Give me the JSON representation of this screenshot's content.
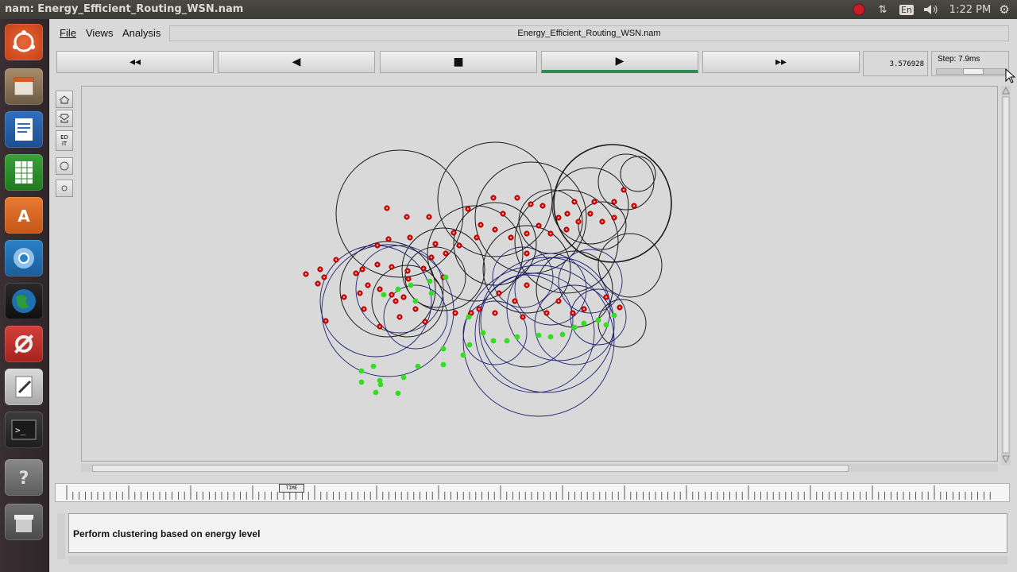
{
  "system": {
    "window_title": "nam: Energy_Efficient_Routing_WSN.nam",
    "clock": "1:22 PM",
    "keyboard_layout": "En"
  },
  "launcher": {
    "items": [
      "ubuntu-home",
      "files",
      "libreoffice-writer",
      "libreoffice-calc",
      "software-center",
      "chromium",
      "earth",
      "system-settings",
      "text-editor",
      "terminal",
      "help",
      "trash"
    ]
  },
  "nam": {
    "menus": [
      "File",
      "Views",
      "Analysis"
    ],
    "filename": "Energy_Efficient_Routing_WSN.nam",
    "controls": {
      "rewind": "◂◂",
      "back": "◀",
      "stop": "■",
      "play": "▶",
      "fast_forward": "▸▸"
    },
    "time": "3.576928",
    "step": "Step: 7.9ms",
    "step_slider_fraction": 0.55,
    "tools": [
      "zoom-in",
      "zoom-out",
      "EDIT",
      "node",
      "small-node"
    ],
    "timeline_marker": "TIME",
    "annotation": "Perform clustering based on energy level"
  },
  "colors": {
    "red_node": "#d90000",
    "green_node": "#33dd22",
    "black_range": "#1a1a1a",
    "blue_range": "#202070",
    "play_active": "#2e8b57"
  }
}
